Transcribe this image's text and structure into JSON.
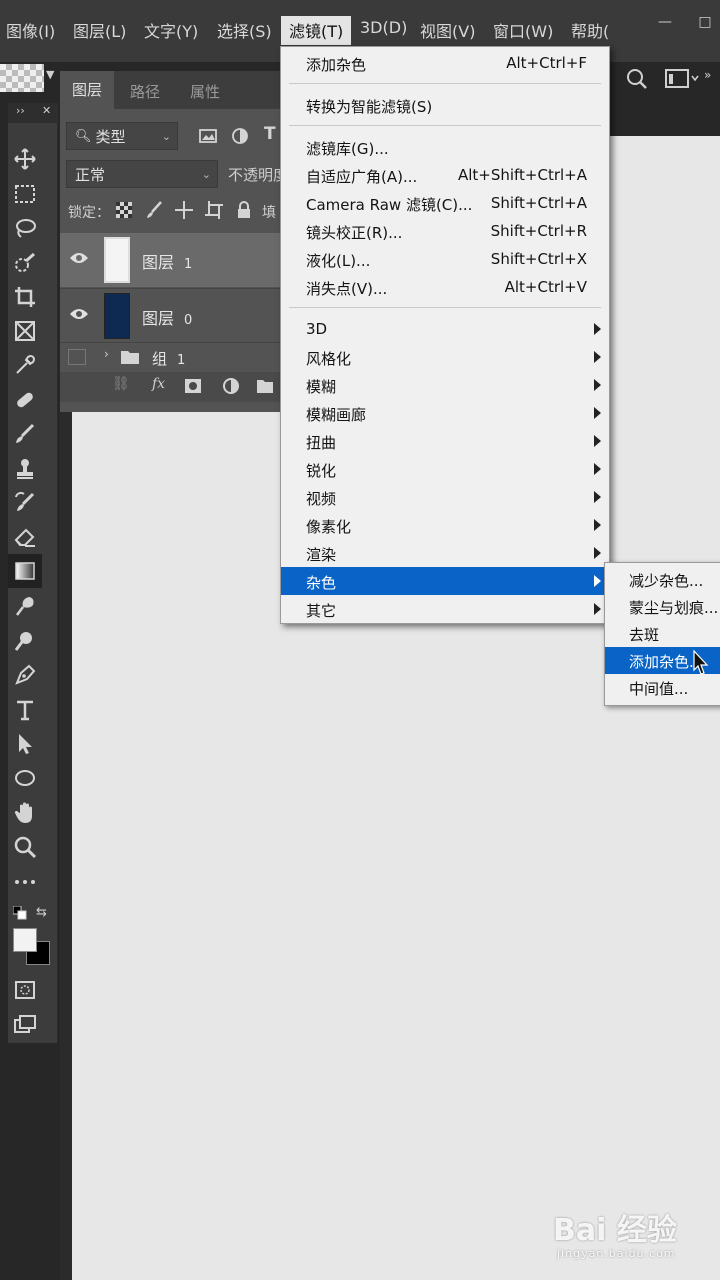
{
  "menubar": {
    "items": [
      {
        "label": "图像(I)"
      },
      {
        "label": "图层(L)"
      },
      {
        "label": "文字(Y)"
      },
      {
        "label": "选择(S)"
      },
      {
        "label": "滤镜(T)"
      },
      {
        "label": "3D(D)"
      },
      {
        "label": "视图(V)"
      },
      {
        "label": "窗口(W)"
      },
      {
        "label": "帮助("
      }
    ],
    "minimize": "—",
    "maximize": "□"
  },
  "options_bar": {
    "more": "»"
  },
  "layers_panel": {
    "tabs": [
      "图层",
      "路径",
      "属性"
    ],
    "filter_kind": "类型",
    "blend_mode": "正常",
    "opacity_label": "不透明度",
    "lock_label": "锁定：",
    "fill_label": "填",
    "layers": [
      {
        "name": "图层",
        "num": "1",
        "thumb": "#f4f4f4",
        "selected": true
      },
      {
        "name": "图层",
        "num": "0",
        "thumb": "#0e2a52",
        "selected": false
      },
      {
        "name": "组",
        "num": "1",
        "thumb": "",
        "selected": false
      }
    ],
    "bottom_fx": "fx"
  },
  "filter_menu": {
    "last_filter": {
      "label": "添加杂色",
      "shortcut": "Alt+Ctrl+F"
    },
    "smart_filter": {
      "label": "转换为智能滤镜(S)"
    },
    "group1": [
      {
        "label": "滤镜库(G)...",
        "shortcut": ""
      },
      {
        "label": "自适应广角(A)...",
        "shortcut": "Alt+Shift+Ctrl+A"
      },
      {
        "label": "Camera Raw 滤镜(C)...",
        "shortcut": "Shift+Ctrl+A"
      },
      {
        "label": "镜头校正(R)...",
        "shortcut": "Shift+Ctrl+R"
      },
      {
        "label": "液化(L)...",
        "shortcut": "Shift+Ctrl+X"
      },
      {
        "label": "消失点(V)...",
        "shortcut": "Alt+Ctrl+V"
      }
    ],
    "submenus": [
      {
        "label": "3D"
      },
      {
        "label": "风格化"
      },
      {
        "label": "模糊"
      },
      {
        "label": "模糊画廊"
      },
      {
        "label": "扭曲"
      },
      {
        "label": "锐化"
      },
      {
        "label": "视频"
      },
      {
        "label": "像素化"
      },
      {
        "label": "渲染"
      },
      {
        "label": "杂色"
      },
      {
        "label": "其它"
      }
    ]
  },
  "noise_submenu": {
    "items": [
      {
        "label": "减少杂色..."
      },
      {
        "label": "蒙尘与划痕..."
      },
      {
        "label": "去斑"
      },
      {
        "label": "添加杂色..."
      },
      {
        "label": "中间值..."
      }
    ]
  },
  "watermark": {
    "main": "Bai 经验",
    "sub": "jingyan.baidu.com"
  },
  "colors": {
    "menu_highlight": "#0a64c8",
    "foreground": "#f2f2f2",
    "background": "#000000"
  }
}
